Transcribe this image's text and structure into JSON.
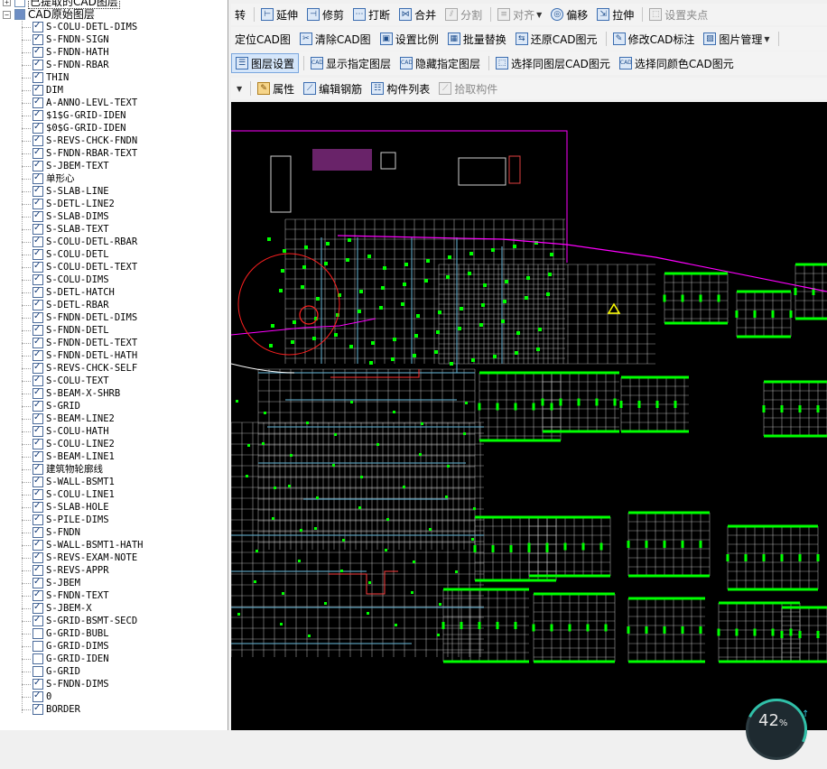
{
  "tree": {
    "extracted_label": "已提取的CAD图层",
    "original_label": "CAD原始图层",
    "layers": [
      {
        "name": "S-COLU-DETL-DIMS",
        "checked": true
      },
      {
        "name": "S-FNDN-SIGN",
        "checked": true
      },
      {
        "name": "S-FNDN-HATH",
        "checked": true
      },
      {
        "name": "S-FNDN-RBAR",
        "checked": true
      },
      {
        "name": "THIN",
        "checked": true
      },
      {
        "name": "DIM",
        "checked": true
      },
      {
        "name": "A-ANNO-LEVL-TEXT",
        "checked": true
      },
      {
        "name": "$1$G-GRID-IDEN",
        "checked": true
      },
      {
        "name": "$0$G-GRID-IDEN",
        "checked": true
      },
      {
        "name": "S-REVS-CHCK-FNDN",
        "checked": true
      },
      {
        "name": "S-FNDN-RBAR-TEXT",
        "checked": true
      },
      {
        "name": "S-JBEM-TEXT",
        "checked": true
      },
      {
        "name": "单形心",
        "checked": true
      },
      {
        "name": "S-SLAB-LINE",
        "checked": true
      },
      {
        "name": "S-DETL-LINE2",
        "checked": true
      },
      {
        "name": "S-SLAB-DIMS",
        "checked": true
      },
      {
        "name": "S-SLAB-TEXT",
        "checked": true
      },
      {
        "name": "S-COLU-DETL-RBAR",
        "checked": true
      },
      {
        "name": "S-COLU-DETL",
        "checked": true
      },
      {
        "name": "S-COLU-DETL-TEXT",
        "checked": true
      },
      {
        "name": "S-COLU-DIMS",
        "checked": true
      },
      {
        "name": "S-DETL-HATCH",
        "checked": true
      },
      {
        "name": "S-DETL-RBAR",
        "checked": true
      },
      {
        "name": "S-FNDN-DETL-DIMS",
        "checked": true
      },
      {
        "name": "S-FNDN-DETL",
        "checked": true
      },
      {
        "name": "S-FNDN-DETL-TEXT",
        "checked": true
      },
      {
        "name": "S-FNDN-DETL-HATH",
        "checked": true
      },
      {
        "name": "S-REVS-CHCK-SELF",
        "checked": true
      },
      {
        "name": "S-COLU-TEXT",
        "checked": true
      },
      {
        "name": "S-BEAM-X-SHRB",
        "checked": true
      },
      {
        "name": "S-GRID",
        "checked": true
      },
      {
        "name": "S-BEAM-LINE2",
        "checked": true
      },
      {
        "name": "S-COLU-HATH",
        "checked": true
      },
      {
        "name": "S-COLU-LINE2",
        "checked": true
      },
      {
        "name": "S-BEAM-LINE1",
        "checked": true
      },
      {
        "name": "建筑物轮廓线",
        "checked": true
      },
      {
        "name": "S-WALL-BSMT1",
        "checked": true
      },
      {
        "name": "S-COLU-LINE1",
        "checked": true
      },
      {
        "name": "S-SLAB-HOLE",
        "checked": true
      },
      {
        "name": "S-PILE-DIMS",
        "checked": true
      },
      {
        "name": "S-FNDN",
        "checked": true
      },
      {
        "name": "S-WALL-BSMT1-HATH",
        "checked": true
      },
      {
        "name": "S-REVS-EXAM-NOTE",
        "checked": true
      },
      {
        "name": "S-REVS-APPR",
        "checked": true
      },
      {
        "name": "S-JBEM",
        "checked": true
      },
      {
        "name": "S-FNDN-TEXT",
        "checked": true
      },
      {
        "name": "S-JBEM-X",
        "checked": true
      },
      {
        "name": "S-GRID-BSMT-SECD",
        "checked": true
      },
      {
        "name": "G-GRID-BUBL",
        "checked": false
      },
      {
        "name": "G-GRID-DIMS",
        "checked": false
      },
      {
        "name": "G-GRID-IDEN",
        "checked": false
      },
      {
        "name": "G-GRID",
        "checked": false
      },
      {
        "name": "S-FNDN-DIMS",
        "checked": true
      },
      {
        "name": "0",
        "checked": true
      },
      {
        "name": "BORDER",
        "checked": true
      }
    ]
  },
  "toolbar1": {
    "partial": "转",
    "extend": "延伸",
    "trim": "修剪",
    "break": "打断",
    "merge": "合并",
    "split": "分割",
    "align": "对齐",
    "offset": "偏移",
    "stretch": "拉伸",
    "set_grip": "设置夹点"
  },
  "toolbar2": {
    "locate": "定位CAD图",
    "clear": "清除CAD图",
    "scale": "设置比例",
    "replace": "批量替换",
    "restore": "还原CAD图元",
    "modify_dim": "修改CAD标注",
    "image_mgr": "图片管理"
  },
  "toolbar3": {
    "layer_settings": "图层设置",
    "show_layer": "显示指定图层",
    "hide_layer": "隐藏指定图层",
    "select_same_layer": "选择同图层CAD图元",
    "select_same_color": "选择同颜色CAD图元"
  },
  "toolbar4": {
    "properties": "属性",
    "edit_rebar": "编辑钢筋",
    "component_list": "构件列表",
    "pick_component": "拾取构件"
  },
  "zoom": {
    "value": "42",
    "unit": "%"
  },
  "colors": {
    "canvas_bg": "#000000",
    "grid": "#d8d8d8",
    "column": "#00ff00",
    "boundary": "#ff00ff",
    "wall": "#ffffff"
  }
}
